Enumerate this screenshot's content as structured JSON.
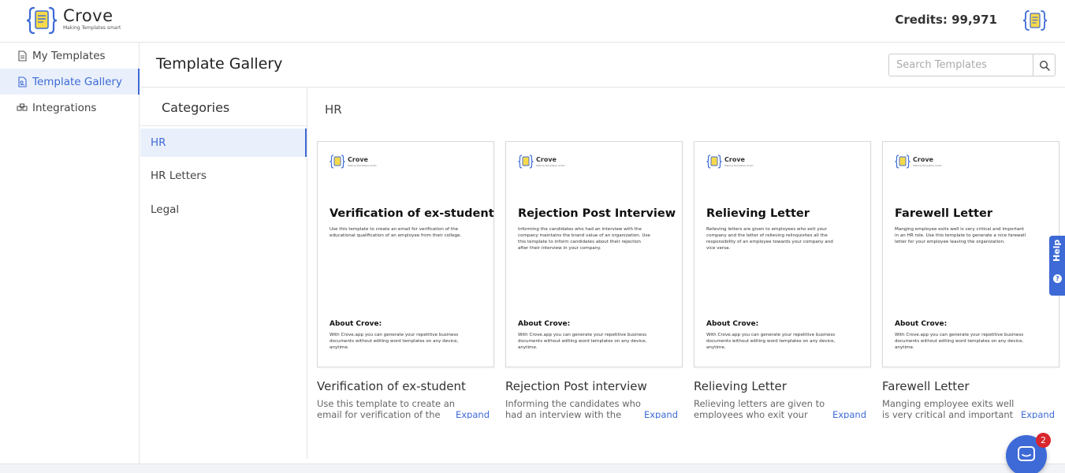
{
  "header": {
    "brand": "Crove",
    "tagline": "Making Templates smart",
    "credits": "Credits: 99,971"
  },
  "sidebar": {
    "items": [
      {
        "label": "My Templates",
        "icon": "file-icon",
        "active": false
      },
      {
        "label": "Template Gallery",
        "icon": "gallery-icon",
        "active": true
      },
      {
        "label": "Integrations",
        "icon": "integrations-icon",
        "active": false
      }
    ]
  },
  "page": {
    "title": "Template Gallery",
    "search_placeholder": "Search Templates"
  },
  "categories": {
    "heading": "Categories",
    "items": [
      {
        "label": "HR",
        "active": true
      },
      {
        "label": "HR Letters",
        "active": false
      },
      {
        "label": "Legal",
        "active": false
      }
    ]
  },
  "section": {
    "title": "HR"
  },
  "templates": [
    {
      "preview_brand": "Crove",
      "preview_tagline": "Making Templates smart",
      "preview_title": "Verification of ex-student",
      "preview_desc": "Use this template to create an email for verification of the educational qualification of an employee from their college.",
      "preview_about_title": "About Crove:",
      "preview_about_text": "With Crove.app you can generate your repetitive business documents without editing word templates on any device, anytime.",
      "name": "Verification of ex-student",
      "description": "Use this template to create an email for verification of the educational qualification of an employee from their college.",
      "expand": "Expand"
    },
    {
      "preview_brand": "Crove",
      "preview_tagline": "Making Templates smart",
      "preview_title": "Rejection Post Interview",
      "preview_desc": "Informing the candidates who had an interview with the company maintains the brand value of an organization. Use this template to inform candidates about their rejection after their interview in your company.",
      "preview_about_title": "About Crove:",
      "preview_about_text": "With Crove.app you can generate your repetitive business documents without editing word templates on any device, anytime.",
      "name": "Rejection Post interview",
      "description": "Informing the candidates who had an interview with the company maintains the brand value of an organization.",
      "expand": "Expand"
    },
    {
      "preview_brand": "Crove",
      "preview_tagline": "Making Templates smart",
      "preview_title": "Relieving Letter",
      "preview_desc": "Relieving letters are given to employees who exit your company and the letter of relieving relinquishes all the responsibility of an employee towards your company and vice versa.",
      "preview_about_title": "About Crove:",
      "preview_about_text": "With Crove.app you can generate your repetitive business documents without editing word templates on any device, anytime.",
      "name": "Relieving Letter",
      "description": "Relieving letters are given to employees who exit your company and the letter of relieving relinquishes all the responsibility.",
      "expand": "Expand"
    },
    {
      "preview_brand": "Crove",
      "preview_tagline": "Making Templates smart",
      "preview_title": "Farewell Letter",
      "preview_desc": "Manging employee exits well is very critical and important in an HR role. Use this template to generate a nice farewell letter for your employee leaving the organization.",
      "preview_about_title": "About Crove:",
      "preview_about_text": "With Crove.app you can generate your repetitive business documents without editing word templates on any device, anytime.",
      "name": "Farewell Letter",
      "description": "Manging employee exits well is very critical and important in an HR role. Use this template to generate a nice farewell letter.",
      "expand": "Expand"
    }
  ],
  "help": {
    "label": "Help"
  },
  "chat": {
    "badge": "2"
  },
  "colors": {
    "accent": "#3d6ad6",
    "active_bg": "#eaf0fb",
    "badge": "#d9262c",
    "border": "#e3e3e3"
  }
}
